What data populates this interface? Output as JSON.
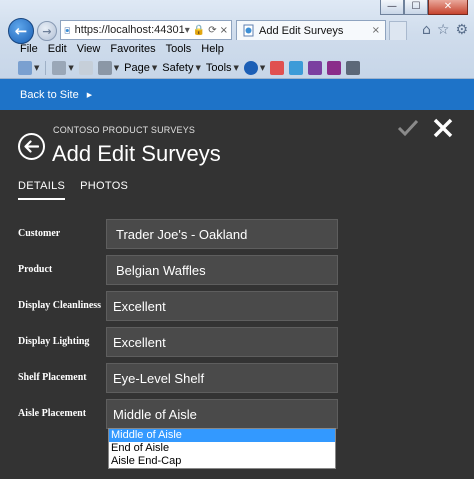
{
  "browser": {
    "address": "https://localhost:44301",
    "tab_title": "Add Edit Surveys",
    "tab_close": "×",
    "window_controls": {
      "minimize": "—",
      "maximize": "☐",
      "close": "✕"
    },
    "menu": [
      "File",
      "Edit",
      "View",
      "Favorites",
      "Tools",
      "Help"
    ],
    "toolbar": {
      "page": "Page",
      "safety": "Safety",
      "tools": "Tools"
    }
  },
  "app": {
    "back_to_site": "Back to Site",
    "subtitle": "CONTOSO PRODUCT SURVEYS",
    "title": "Add Edit Surveys",
    "tabs": [
      "DETAILS",
      "PHOTOS"
    ],
    "fields": [
      {
        "label": "Customer",
        "value": "Trader Joe's - Oakland"
      },
      {
        "label": "Product",
        "value": "Belgian Waffles"
      },
      {
        "label": "Display Cleanliness",
        "value": "Excellent"
      },
      {
        "label": "Display Lighting",
        "value": "Excellent"
      },
      {
        "label": "Shelf Placement",
        "value": "Eye-Level Shelf"
      },
      {
        "label": "Aisle Placement",
        "value": "Middle of Aisle"
      }
    ],
    "dropdown_options": [
      "Middle of Aisle",
      "End of Aisle",
      "Aisle End-Cap"
    ],
    "colors": {
      "accent": "#1e73c8",
      "background": "#333333",
      "field": "#4a4a4a",
      "selected_option": "#3399ff"
    }
  }
}
